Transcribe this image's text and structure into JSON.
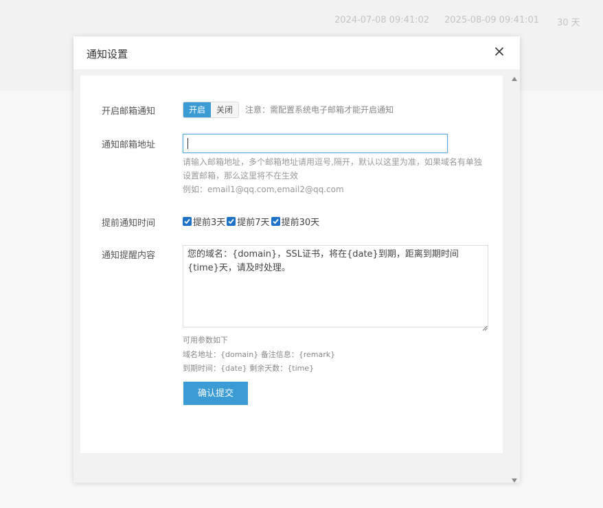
{
  "background": {
    "row": {
      "start_date": "2024-07-08 09:41:02",
      "end_date": "2025-08-09 09:41:01",
      "days_left": "30 天"
    }
  },
  "modal": {
    "title": "通知设置",
    "email_notify": {
      "label": "开启邮箱通知",
      "on_label": "开启",
      "off_label": "关闭",
      "selected": "开启",
      "notice": "注意：需配置系统电子邮箱才能开启通知"
    },
    "email_address": {
      "label": "通知邮箱地址",
      "value": "",
      "placeholder": "",
      "help_line1": "请输入邮箱地址，多个邮箱地址请用逗号,隔开，默认以这里为准，如果域名有单独",
      "help_line2": "设置邮箱，那么这里将不在生效",
      "help_example": "例如：email1@qq.com,email2@qq.com"
    },
    "advance_notice": {
      "label": "提前通知时间",
      "options": [
        {
          "label": "提前3天",
          "checked": true
        },
        {
          "label": "提前7天",
          "checked": true
        },
        {
          "label": "提前30天",
          "checked": true
        }
      ]
    },
    "content": {
      "label": "通知提醒内容",
      "value": "您的域名：{domain}，SSL证书，将在{date}到期，距离到期时间{time}天，请及时处理。"
    },
    "params": {
      "title": "可用参数如下",
      "line1": "域名地址：{domain} 备注信息：{remark}",
      "line2": "到期时间：{date} 剩余天数：{time}"
    },
    "submit_label": "确认提交"
  },
  "colors": {
    "accent": "#3a9bd5",
    "checkbox": "#1e73c8"
  }
}
